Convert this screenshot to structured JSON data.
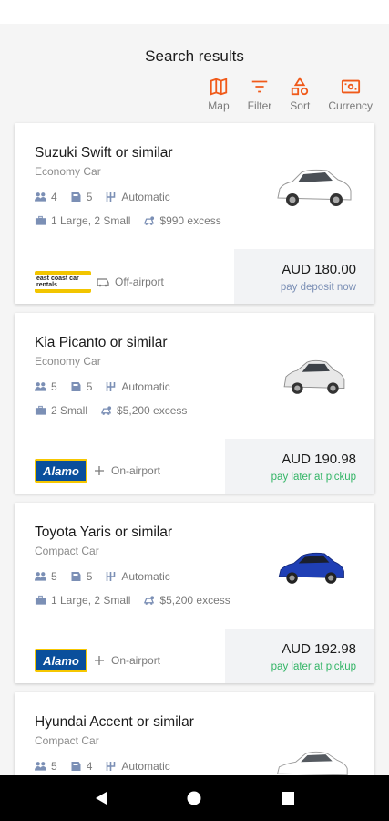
{
  "header": {
    "title": "Search results"
  },
  "toolbar": [
    {
      "label": "Map",
      "icon": "map-icon"
    },
    {
      "label": "Filter",
      "icon": "filter-icon"
    },
    {
      "label": "Sort",
      "icon": "sort-icon"
    },
    {
      "label": "Currency",
      "icon": "currency-icon"
    }
  ],
  "accent_color": "#f05a1a",
  "cars": [
    {
      "name": "Suzuki Swift or similar",
      "class": "Economy Car",
      "passengers": "4",
      "doors": "5",
      "transmission": "Automatic",
      "luggage": "1 Large, 2 Small",
      "excess": "$990 excess",
      "supplier": "east coast car rentals",
      "location": "Off-airport",
      "price": "AUD 180.00",
      "payment": "pay deposit now",
      "car_color": "#ffffff"
    },
    {
      "name": "Kia Picanto or similar",
      "class": "Economy Car",
      "passengers": "5",
      "doors": "5",
      "transmission": "Automatic",
      "luggage": "2 Small",
      "excess": "$5,200 excess",
      "supplier": "Alamo",
      "location": "On-airport",
      "price": "AUD 190.98",
      "payment": "pay later at pickup",
      "car_color": "#e8e8e8"
    },
    {
      "name": "Toyota Yaris or similar",
      "class": "Compact Car",
      "passengers": "5",
      "doors": "5",
      "transmission": "Automatic",
      "luggage": "1 Large, 2 Small",
      "excess": "$5,200 excess",
      "supplier": "Alamo",
      "location": "On-airport",
      "price": "AUD 192.98",
      "payment": "pay later at pickup",
      "car_color": "#1f3fb5"
    },
    {
      "name": "Hyundai Accent or similar",
      "class": "Compact Car",
      "passengers": "5",
      "doors": "4",
      "transmission": "Automatic",
      "car_color": "#ffffff"
    }
  ]
}
